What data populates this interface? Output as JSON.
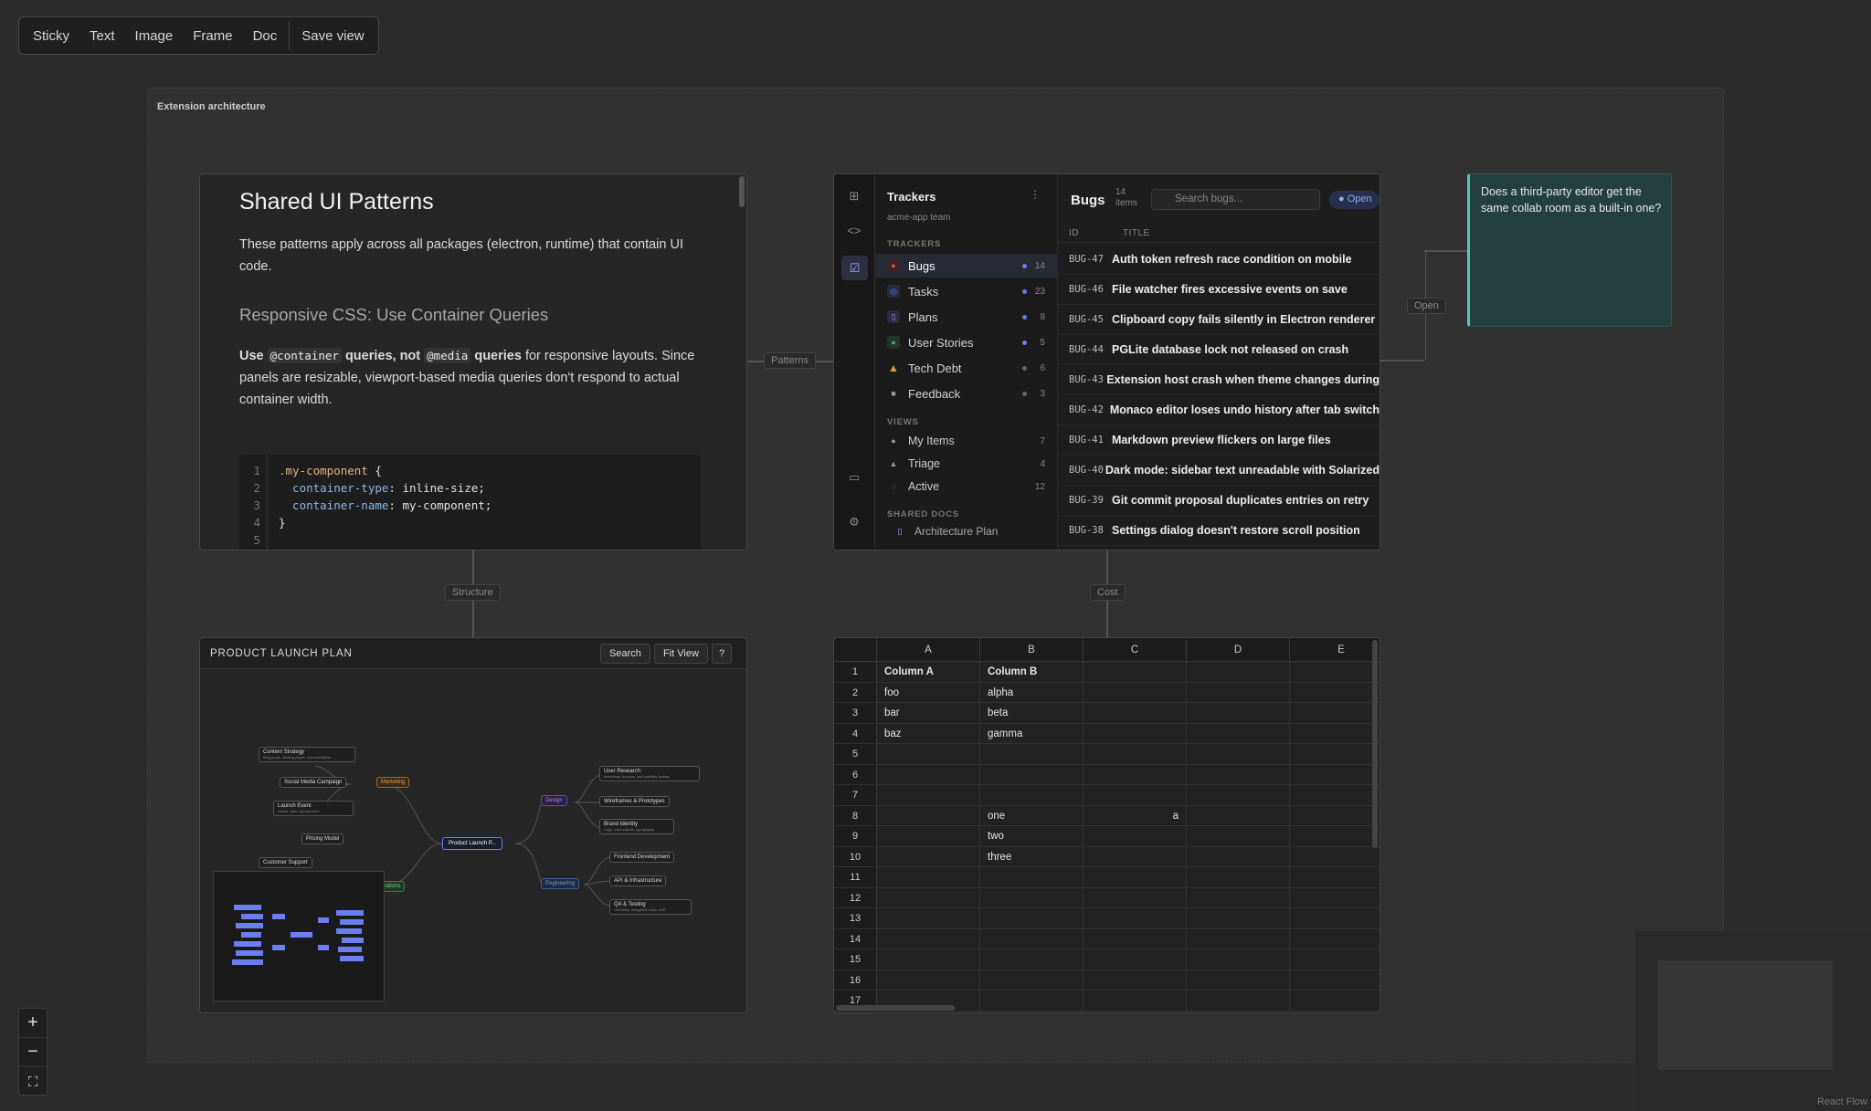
{
  "toolbar": {
    "items": [
      "Sticky",
      "Text",
      "Image",
      "Frame",
      "Doc",
      "Save view"
    ]
  },
  "frame": {
    "title": "Extension architecture"
  },
  "edges": {
    "patterns": "Patterns",
    "structure": "Structure",
    "cost": "Cost",
    "open": "Open"
  },
  "doc": {
    "title": "Shared UI Patterns",
    "intro": "These patterns apply across all packages (electron, runtime) that contain UI code.",
    "h2": "Responsive CSS: Use Container Queries",
    "p_use": "Use",
    "p_code1": "@container",
    "p_mid1": "queries, not",
    "p_code2": "@media",
    "p_mid2": "queries",
    "p_rest": "for responsive layouts. Since panels are resizable, viewport-based media queries don't respond to actual container width.",
    "code": {
      "line_numbers": [
        "1",
        "2",
        "3",
        "4",
        "5"
      ],
      "l1_sel": ".my-component",
      "l1_brace": " {",
      "l2_prop": "  container-type",
      "l2_val": ": inline-size;",
      "l3_prop": "  container-name",
      "l3_val": ": my-component;",
      "l4": "}"
    }
  },
  "trackers": {
    "title": "Trackers",
    "team": "acme-app team",
    "sec_trackers": "TRACKERS",
    "items": [
      {
        "label": "Bugs",
        "count": "14",
        "color": "#e05555",
        "icon": "bug-icon"
      },
      {
        "label": "Tasks",
        "count": "23",
        "color": "#6b7ff0",
        "icon": "task-icon"
      },
      {
        "label": "Plans",
        "count": "8",
        "color": "#a78bfa",
        "icon": "plan-icon"
      },
      {
        "label": "User Stories",
        "count": "5",
        "color": "#4caf7a",
        "icon": "user-icon"
      },
      {
        "label": "Tech Debt",
        "count": "6",
        "color": "#e0a030",
        "icon": "warning-icon"
      },
      {
        "label": "Feedback",
        "count": "3",
        "color": "#888888",
        "icon": "chat-icon"
      }
    ],
    "sec_views": "VIEWS",
    "views": [
      {
        "label": "My Items",
        "count": "7"
      },
      {
        "label": "Triage",
        "count": "4"
      },
      {
        "label": "Active",
        "count": "12"
      }
    ],
    "sec_docs": "SHARED DOCS",
    "docs": [
      "Architecture Plan"
    ],
    "bugs": {
      "title": "Bugs",
      "count_num": "14",
      "count_label": "items",
      "search_placeholder": "Search bugs...",
      "filter": "Open",
      "col_id": "ID",
      "col_title": "TITLE",
      "rows": [
        {
          "id": "BUG-47",
          "title": "Auth token refresh race condition on mobile"
        },
        {
          "id": "BUG-46",
          "title": "File watcher fires excessive events on save"
        },
        {
          "id": "BUG-45",
          "title": "Clipboard copy fails silently in Electron renderer"
        },
        {
          "id": "BUG-44",
          "title": "PGLite database lock not released on crash"
        },
        {
          "id": "BUG-43",
          "title": "Extension host crash when theme changes during"
        },
        {
          "id": "BUG-42",
          "title": "Monaco editor loses undo history after tab switch"
        },
        {
          "id": "BUG-41",
          "title": "Markdown preview flickers on large files"
        },
        {
          "id": "BUG-40",
          "title": "Dark mode: sidebar text unreadable with Solarized"
        },
        {
          "id": "BUG-39",
          "title": "Git commit proposal duplicates entries on retry"
        },
        {
          "id": "BUG-38",
          "title": "Settings dialog doesn't restore scroll position"
        }
      ]
    }
  },
  "sticky": {
    "text": "Does a third-party editor get the same collab room as a built-in one?"
  },
  "mindmap": {
    "title": "PRODUCT LAUNCH PLAN",
    "btn_search": "Search",
    "btn_fit": "Fit View",
    "btn_help": "?",
    "nodes": {
      "root": "Product Launch P...",
      "marketing": "Marketing",
      "design": "Design",
      "engineering": "Engineering",
      "operations": "erations",
      "content": "Content Strategy",
      "content_sub": "Blog posts, landing pages, documentation",
      "social": "Social Media Campaign",
      "launch": "Launch Event",
      "launch_sub": "Venue, date, product tech",
      "pricing": "Pricing Model",
      "support": "Customer Support",
      "research": "User Research",
      "research_sub": "Interviews, surveys, and usability testing",
      "wireframes": "Wireframes & Prototypes",
      "brand": "Brand Identity",
      "brand_sub": "Logo, color palette, typography",
      "frontend": "Frontend Development",
      "api": "API & Infrastructure",
      "qa": "QA & Testing",
      "qa_sub": "Unit tests, integration tests, E2E"
    }
  },
  "sheet": {
    "columns": [
      "A",
      "B",
      "C",
      "D",
      "E"
    ],
    "rows": [
      [
        "Column A",
        "Column B",
        "",
        "",
        ""
      ],
      [
        "foo",
        "alpha",
        "",
        "",
        ""
      ],
      [
        "bar",
        "beta",
        "",
        "",
        ""
      ],
      [
        "baz",
        "gamma",
        "",
        "",
        ""
      ],
      [
        "",
        "",
        "",
        "",
        ""
      ],
      [
        "",
        "",
        "",
        "",
        ""
      ],
      [
        "",
        "",
        "",
        "",
        ""
      ],
      [
        "",
        "one",
        "a",
        "",
        ""
      ],
      [
        "",
        "two",
        "",
        "",
        ""
      ],
      [
        "",
        "three",
        "",
        "",
        ""
      ],
      [
        "",
        "",
        "",
        "",
        ""
      ],
      [
        "",
        "",
        "",
        "",
        ""
      ],
      [
        "",
        "",
        "",
        "",
        ""
      ],
      [
        "",
        "",
        "",
        "",
        ""
      ],
      [
        "",
        "",
        "",
        "",
        ""
      ],
      [
        "",
        "",
        "",
        "",
        ""
      ],
      [
        "",
        "",
        "",
        "",
        ""
      ]
    ]
  },
  "attribution": "React Flow"
}
